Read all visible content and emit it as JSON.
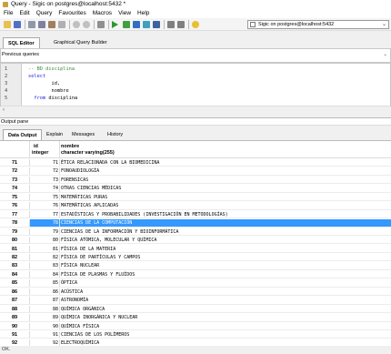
{
  "window": {
    "title": "Query - Sigic on postgres@localhost:5432 *"
  },
  "menu": [
    "File",
    "Edit",
    "Query",
    "Favourites",
    "Macros",
    "View",
    "Help"
  ],
  "toolbar": {
    "connection_label": "Sigic on postgres@localhost:5432",
    "icons": [
      "open-icon",
      "save-icon",
      "cut-icon",
      "copy-icon",
      "paste-icon",
      "clear-icon",
      "undo-icon",
      "redo-icon",
      "find-icon",
      "execute-icon",
      "explain-icon",
      "explain-analyze-icon",
      "cancel-icon",
      "execute-pgscript-icon",
      "output-to-file-icon",
      "clear-history-icon",
      "help-icon"
    ]
  },
  "editor_tabs": [
    "SQL Editor",
    "Graphical Query Builder"
  ],
  "previous_queries_label": "Previous queries",
  "editor": {
    "lines": [
      {
        "n": "1",
        "text": "-- BD disciplina",
        "kind": "comment"
      },
      {
        "n": "2",
        "text": "select",
        "kind": "kw"
      },
      {
        "n": "3",
        "text": "        id,",
        "kind": "plain"
      },
      {
        "n": "4",
        "text": "        nombre",
        "kind": "plain"
      },
      {
        "n": "5",
        "text": "  from disciplina",
        "kind": "from"
      }
    ]
  },
  "output_pane_label": "Output pane",
  "output_tabs": [
    "Data Output",
    "Explain",
    "Messages",
    "History"
  ],
  "grid": {
    "columns": [
      {
        "name": "id",
        "type": "integer"
      },
      {
        "name": "nombre",
        "type": "character varying(255)"
      }
    ],
    "selected_row": "78",
    "rows": [
      {
        "rn": "71",
        "id": "71",
        "nombre": "ÉTICA RELACIONADA CON LA BIOMEDICINA"
      },
      {
        "rn": "72",
        "id": "72",
        "nombre": "FONOAUDIOLOGÍA"
      },
      {
        "rn": "73",
        "id": "73",
        "nombre": "FORENSICAS"
      },
      {
        "rn": "74",
        "id": "74",
        "nombre": "OTRAS CIENCIAS MÉDICAS"
      },
      {
        "rn": "75",
        "id": "75",
        "nombre": "MATEMÁTICAS PURAS"
      },
      {
        "rn": "76",
        "id": "76",
        "nombre": "MATEMÁTICAS APLICADAS"
      },
      {
        "rn": "77",
        "id": "77",
        "nombre": "ESTADÍSTICAS Y PROBABILIDADES (INVESTIGACIÓN EN METODOLOGÍAS)"
      },
      {
        "rn": "78",
        "id": "78",
        "nombre": "CIENCIAS DE LA COMPUTACIÓN"
      },
      {
        "rn": "79",
        "id": "79",
        "nombre": "CIENCIAS DE LA INFORMACIÓN Y BIOINFORMÁTICA"
      },
      {
        "rn": "80",
        "id": "80",
        "nombre": "FÍSICA ATÓMICA, MOLECULAR Y QUÍMICA"
      },
      {
        "rn": "81",
        "id": "81",
        "nombre": "FÍSICA DE LA MATERIA"
      },
      {
        "rn": "82",
        "id": "82",
        "nombre": "FÍSICA DE PARTÍCULAS Y CAMPOS"
      },
      {
        "rn": "83",
        "id": "83",
        "nombre": "FÍSICA NUCLEAR"
      },
      {
        "rn": "84",
        "id": "84",
        "nombre": "FÍSICA DE PLASMAS Y FLUÍDOS"
      },
      {
        "rn": "85",
        "id": "85",
        "nombre": "ÓPTICA"
      },
      {
        "rn": "86",
        "id": "86",
        "nombre": "ACÚSTICA"
      },
      {
        "rn": "87",
        "id": "87",
        "nombre": "ASTRONOMÍA"
      },
      {
        "rn": "88",
        "id": "88",
        "nombre": "QUÍMICA ORGÁNICA"
      },
      {
        "rn": "89",
        "id": "89",
        "nombre": "QUÍMICA INORGÁNICA Y NUCLEAR"
      },
      {
        "rn": "90",
        "id": "90",
        "nombre": "QUÍMICA FÍSICA"
      },
      {
        "rn": "91",
        "id": "91",
        "nombre": "CIENCIAS DE LOS POLÍMEROS"
      },
      {
        "rn": "92",
        "id": "92",
        "nombre": "ELECTROQUÍMICA"
      }
    ]
  },
  "status_text": "OK.",
  "colors": {
    "selection": "#3399ff",
    "comment": "#3a8a3a",
    "keyword": "#1a1ad6"
  }
}
